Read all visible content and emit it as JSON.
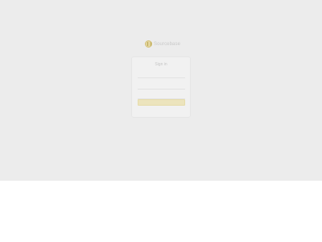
{
  "logo": {
    "brand_primary": "Sourcebase",
    "brand_suffix": "",
    "icon": "coin-icon"
  },
  "signin": {
    "title": "Sign in",
    "username_placeholder": "",
    "password_placeholder": "",
    "remember_label": "",
    "submit_label": "",
    "forgot_link": ""
  },
  "colors": {
    "page_bg": "#ececec",
    "card_bg": "#f1f1f1",
    "accent": "#ece4bd",
    "logo_accent": "#d8c98a"
  }
}
